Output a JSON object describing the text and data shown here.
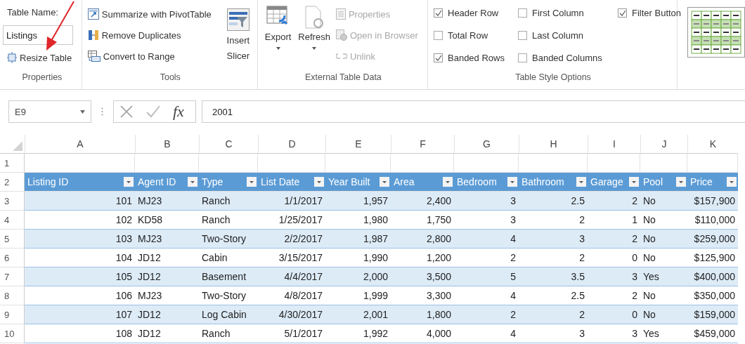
{
  "ribbon": {
    "properties": {
      "label": "Properties",
      "name_label": "Table Name:",
      "name_value": "Listings",
      "resize": "Resize Table"
    },
    "tools": {
      "label": "Tools",
      "buttons": [
        {
          "kind": "pivot",
          "label": "Summarize with PivotTable"
        },
        {
          "kind": "duplicates",
          "label": "Remove Duplicates"
        },
        {
          "kind": "convert",
          "label": "Convert to Range"
        }
      ],
      "slicer": "Insert Slicer"
    },
    "external": {
      "label": "External Table Data",
      "big": [
        {
          "kind": "export",
          "label": "Export"
        },
        {
          "kind": "refresh",
          "label": "Refresh"
        }
      ],
      "small": [
        {
          "kind": "properties",
          "label": "Properties",
          "disabled": true
        },
        {
          "kind": "browser",
          "label": "Open in Browser",
          "disabled": true
        },
        {
          "kind": "unlink",
          "label": "Unlink",
          "disabled": true
        }
      ]
    },
    "style_options": {
      "label": "Table Style Options",
      "options": [
        {
          "kind": "header",
          "label": "Header Row",
          "checked": true
        },
        {
          "kind": "total",
          "label": "Total Row",
          "checked": false
        },
        {
          "kind": "banded_rows",
          "label": "Banded Rows",
          "checked": true
        },
        {
          "kind": "first",
          "label": "First Column",
          "checked": false
        },
        {
          "kind": "last",
          "label": "Last Column",
          "checked": false
        },
        {
          "kind": "banded_columns",
          "label": "Banded Columns",
          "checked": false
        },
        {
          "kind": "filter",
          "label": "Filter Button",
          "checked": true
        }
      ]
    }
  },
  "formula_bar": {
    "name_box": "E9",
    "function_label": "fx",
    "value": "2001"
  },
  "sheet": {
    "column_letters": [
      "A",
      "B",
      "C",
      "D",
      "E",
      "F",
      "G",
      "H",
      "I",
      "J",
      "K"
    ],
    "row_numbers": [
      "1",
      "2",
      "3",
      "4",
      "5",
      "6",
      "7",
      "8",
      "9",
      "10"
    ],
    "columns": [
      {
        "name": "Listing ID",
        "kind": "number"
      },
      {
        "name": "Agent ID",
        "kind": "text"
      },
      {
        "name": "Type",
        "kind": "text"
      },
      {
        "name": "List Date",
        "kind": "number"
      },
      {
        "name": "Year Built",
        "kind": "number"
      },
      {
        "name": "Area",
        "kind": "number"
      },
      {
        "name": "Bedroom",
        "kind": "number"
      },
      {
        "name": "Bathroom",
        "kind": "number"
      },
      {
        "name": "Garage",
        "kind": "number"
      },
      {
        "name": "Pool",
        "kind": "text"
      },
      {
        "name": "Price",
        "kind": "number"
      }
    ],
    "rows": [
      [
        "101",
        "MJ23",
        "Ranch",
        "1/1/2017",
        "1,957",
        "2,400",
        "3",
        "2.5",
        "2",
        "No",
        "$157,900"
      ],
      [
        "102",
        "KD58",
        "Ranch",
        "1/25/2017",
        "1,980",
        "1,750",
        "3",
        "2",
        "1",
        "No",
        "$110,000"
      ],
      [
        "103",
        "MJ23",
        "Two-Story",
        "2/2/2017",
        "1,987",
        "2,800",
        "4",
        "3",
        "2",
        "No",
        "$259,000"
      ],
      [
        "104",
        "JD12",
        "Cabin",
        "3/15/2017",
        "1,990",
        "1,200",
        "2",
        "2",
        "0",
        "No",
        "$125,900"
      ],
      [
        "105",
        "JD12",
        "Basement",
        "4/4/2017",
        "2,000",
        "3,500",
        "5",
        "3.5",
        "3",
        "Yes",
        "$400,000"
      ],
      [
        "106",
        "MJ23",
        "Two-Story",
        "4/8/2017",
        "1,999",
        "3,300",
        "4",
        "2.5",
        "2",
        "No",
        "$350,000"
      ],
      [
        "107",
        "JD12",
        "Log Cabin",
        "4/30/2017",
        "2,001",
        "1,800",
        "2",
        "2",
        "0",
        "No",
        "$159,000"
      ],
      [
        "108",
        "JD12",
        "Ranch",
        "5/1/2017",
        "1,992",
        "4,000",
        "4",
        "3",
        "3",
        "Yes",
        "$459,000"
      ]
    ]
  }
}
